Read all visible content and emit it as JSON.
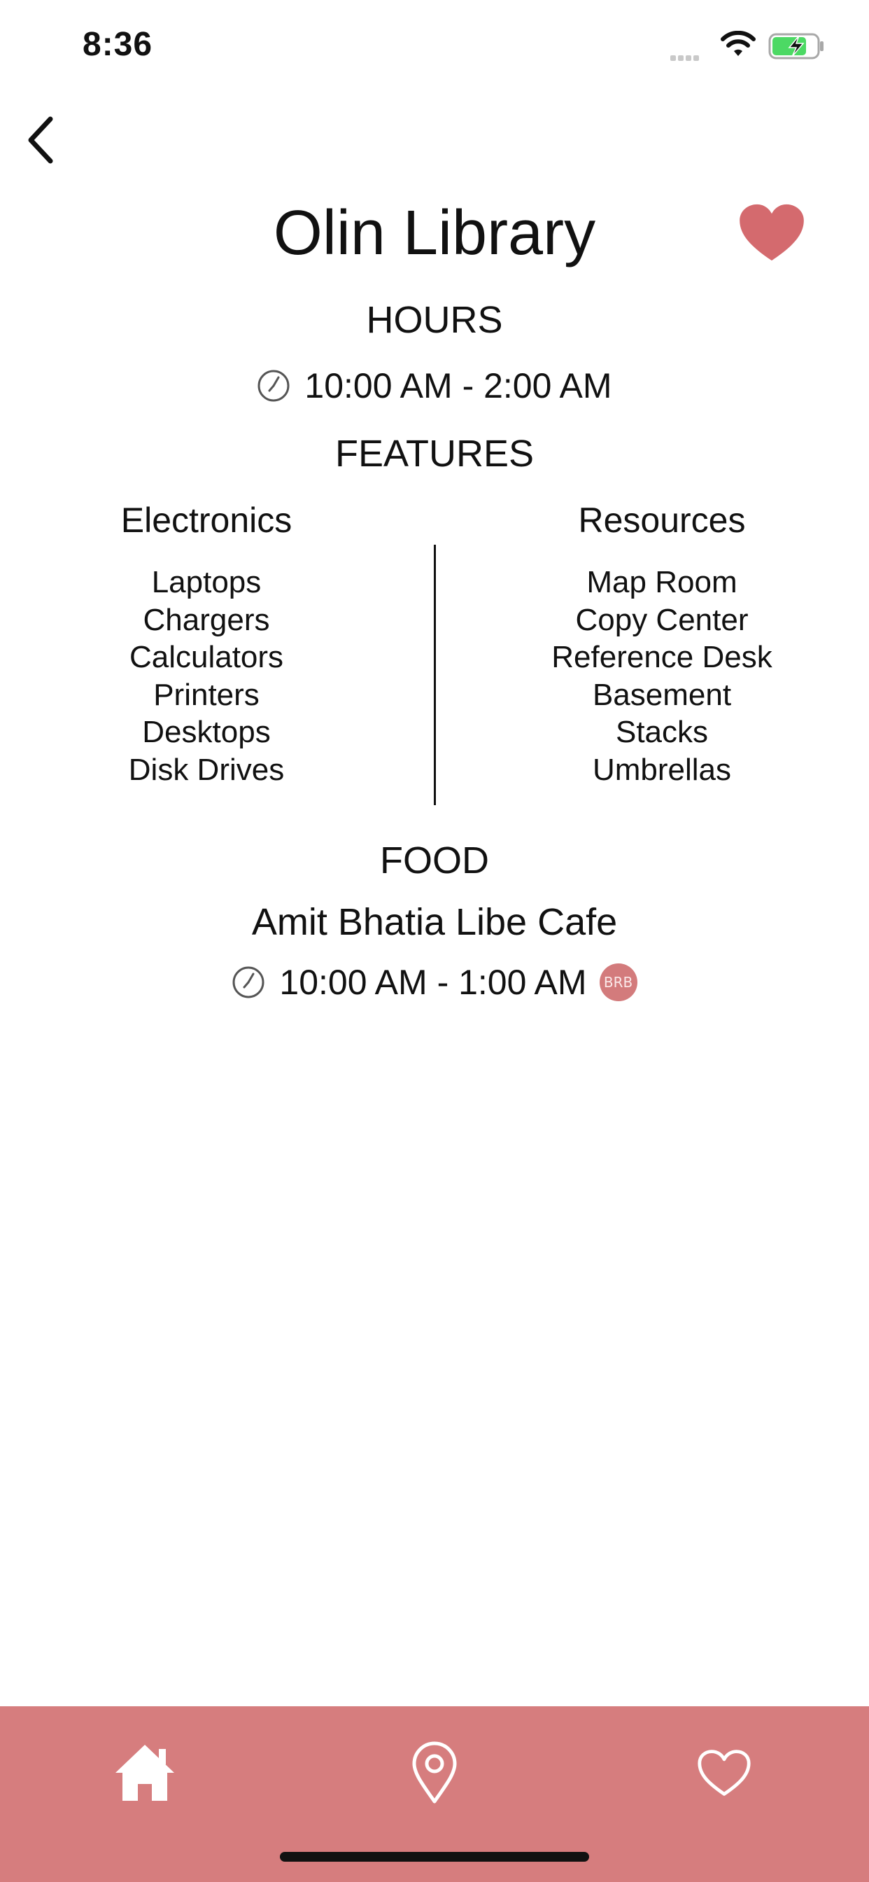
{
  "status_bar": {
    "time": "8:36"
  },
  "header": {
    "title": "Olin Library"
  },
  "hours": {
    "heading": "HOURS",
    "value": "10:00 AM - 2:00 AM"
  },
  "features": {
    "heading": "FEATURES",
    "electronics": {
      "title": "Electronics",
      "items": [
        "Laptops",
        "Chargers",
        "Calculators",
        "Printers",
        "Desktops",
        "Disk Drives"
      ]
    },
    "resources": {
      "title": "Resources",
      "items": [
        "Map Room",
        "Copy Center",
        "Reference Desk",
        "Basement",
        "Stacks",
        "Umbrellas"
      ]
    }
  },
  "food": {
    "heading": "FOOD",
    "cafe_name": "Amit Bhatia Libe Cafe",
    "cafe_hours": "10:00 AM - 1:00 AM",
    "badge": "BRB"
  },
  "tabbar": {
    "items": [
      "home-icon",
      "location-pin-icon",
      "heart-icon"
    ]
  },
  "colors": {
    "accent": "#d67d7e",
    "favorite": "#d46a6e"
  }
}
